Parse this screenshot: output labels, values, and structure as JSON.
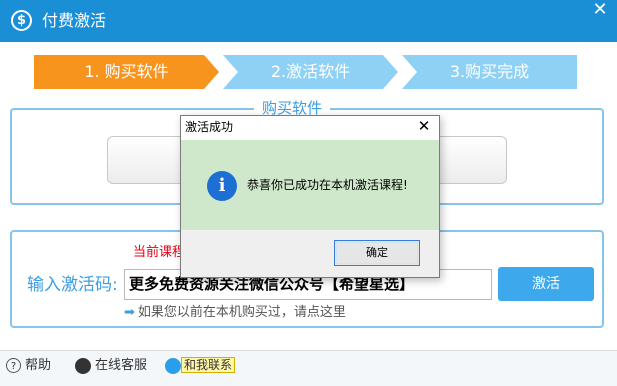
{
  "window": {
    "title": "付费激活",
    "app_icon": "dollar-icon"
  },
  "steps": [
    {
      "label": "1. 购买软件",
      "active": true
    },
    {
      "label": "2.激活软件",
      "active": false
    },
    {
      "label": "3.购买完成",
      "active": false
    }
  ],
  "buy_section": {
    "legend": "购买软件"
  },
  "activation": {
    "current_note": "当前课程",
    "code_label": "输入激活码:",
    "code_value": "更多免费资源关注微信公众号【希望星选】",
    "activate_button": "激活",
    "already_bought_link": "如果您以前在本机购买过，请点这里"
  },
  "footer": {
    "help": "帮助",
    "online_service": "在线客服",
    "contact": "和我联系"
  },
  "dialog": {
    "title": "激活成功",
    "message": "恭喜你已成功在本机激活课程!",
    "ok_button": "确定",
    "icon": "info-icon"
  },
  "colors": {
    "title_bar": "#1a8fd6",
    "active_step": "#f7941d",
    "inactive_step": "#8fd1f5",
    "accent": "#3a9ee0"
  }
}
